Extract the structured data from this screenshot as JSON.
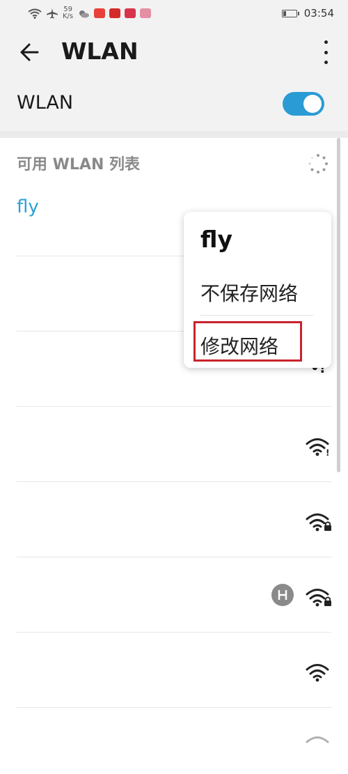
{
  "status_bar": {
    "speed_value": "59",
    "speed_unit": "K/s",
    "time": "03:54",
    "icons": [
      "wifi-icon",
      "airplane-icon",
      "weather-icon",
      "app-icon",
      "tmall-icon",
      "app-icon",
      "app-icon",
      "battery-icon"
    ]
  },
  "app_bar": {
    "title": "WLAN",
    "back_icon": "arrow-left-icon",
    "more_icon": "more-vertical-icon"
  },
  "wlan_toggle": {
    "label": "WLAN",
    "state": "on"
  },
  "available_list": {
    "header": "可用 WLAN 列表",
    "networks": [
      {
        "name": "fly"
      },
      {
        "name": ""
      },
      {
        "name": ""
      },
      {
        "name": ""
      },
      {
        "name": ""
      },
      {
        "name": ""
      },
      {
        "name": ""
      },
      {
        "name": ""
      }
    ]
  },
  "context_menu": {
    "title": "fly",
    "items": [
      "不保存网络",
      "修改网络"
    ],
    "highlighted": "修改网络"
  },
  "colors": {
    "accent": "#2a9bd5",
    "network_active": "#2aa2d6",
    "highlight_border": "#c8232c"
  }
}
